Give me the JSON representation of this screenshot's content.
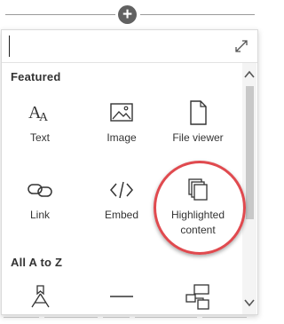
{
  "toolbar": {
    "add_label": "+"
  },
  "search": {
    "value": "",
    "placeholder": ""
  },
  "sections": {
    "featured": "Featured",
    "all": "All A to Z"
  },
  "featured_items": [
    {
      "label": "Text",
      "icon": "text-icon"
    },
    {
      "label": "Image",
      "icon": "image-icon"
    },
    {
      "label": "File viewer",
      "icon": "file-icon"
    },
    {
      "label": "Link",
      "icon": "link-icon"
    },
    {
      "label": "Embed",
      "icon": "embed-icon"
    },
    {
      "label": "Highlighted content",
      "icon": "highlighted-content-icon"
    }
  ],
  "az_items": [
    {
      "label": "",
      "icon": "bookmark-pin-icon"
    },
    {
      "label": "",
      "icon": "divider-icon"
    },
    {
      "label": "",
      "icon": "hierarchy-icon"
    }
  ],
  "annotation": {
    "ring_color": "#e04a4f"
  },
  "colors": {
    "text": "#333333",
    "add_button": "#616161",
    "scroll_thumb": "#c8c8c8"
  }
}
